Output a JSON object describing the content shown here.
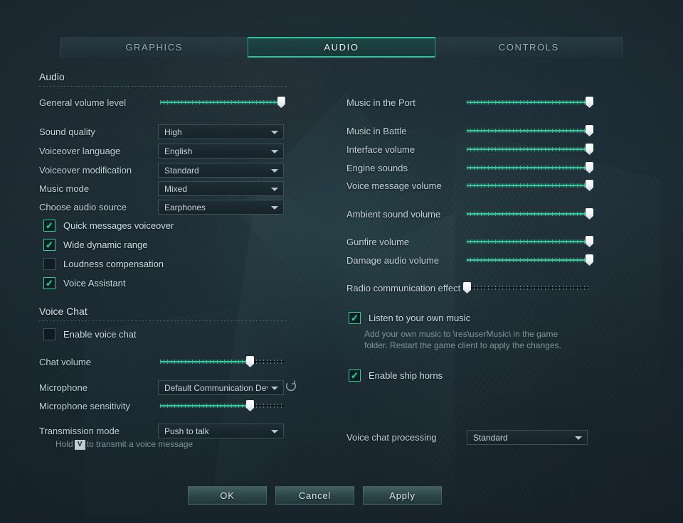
{
  "tabs": [
    {
      "label": "GRAPHICS",
      "active": false
    },
    {
      "label": "AUDIO",
      "active": true
    },
    {
      "label": "CONTROLS",
      "active": false
    }
  ],
  "sections": {
    "audio_title": "Audio",
    "voice_chat_title": "Voice Chat"
  },
  "left": {
    "general_volume": {
      "label": "General volume level",
      "value": 97
    },
    "dropdowns": [
      {
        "label": "Sound quality",
        "value": "High"
      },
      {
        "label": "Voiceover language",
        "value": "English"
      },
      {
        "label": "Voiceover modification",
        "value": "Standard"
      },
      {
        "label": "Music mode",
        "value": "Mixed"
      },
      {
        "label": "Choose audio source",
        "value": "Earphones"
      }
    ],
    "checkboxes": [
      {
        "label": "Quick messages voiceover",
        "checked": true
      },
      {
        "label": "Wide dynamic range",
        "checked": true
      },
      {
        "label": "Loudness compensation",
        "checked": false
      },
      {
        "label": "Voice Assistant",
        "checked": true
      }
    ],
    "enable_voice_chat": {
      "label": "Enable voice chat",
      "checked": false
    },
    "chat_volume": {
      "label": "Chat volume",
      "value": 72
    },
    "microphone": {
      "label": "Microphone",
      "value": "Default Communication Device"
    },
    "microphone_sensitivity": {
      "label": "Microphone sensitivity",
      "value": 72
    },
    "transmission_mode": {
      "label": "Transmission mode",
      "value": "Push to talk"
    },
    "push_hint": {
      "prefix": "Hold",
      "key": "V",
      "suffix": "to transmit a voice message"
    }
  },
  "right": {
    "sliders": [
      {
        "label": "Music in the Port",
        "value": 100
      },
      {
        "label": "Music in Battle",
        "value": 100
      },
      {
        "label": "Interface volume",
        "value": 100
      },
      {
        "label": "Engine sounds",
        "value": 100
      },
      {
        "label": "Voice message volume",
        "value": 100
      },
      {
        "label": "Ambient sound volume",
        "value": 100
      },
      {
        "label": "Gunfire volume",
        "value": 100
      },
      {
        "label": "Damage audio volume",
        "value": 100
      },
      {
        "label": "Radio communication effect",
        "value": 0
      }
    ],
    "own_music": {
      "label": "Listen to your own music",
      "checked": true
    },
    "own_music_hint": "Add your own music to \\res\\userMusic\\ in the game folder. Restart the game client to apply the changes.",
    "ship_horns": {
      "label": "Enable ship horns",
      "checked": true
    },
    "voice_chat_processing": {
      "label": "Voice chat processing",
      "value": "Standard"
    }
  },
  "buttons": [
    {
      "label": "OK"
    },
    {
      "label": "Cancel"
    },
    {
      "label": "Apply"
    }
  ],
  "colors": {
    "accent": "#2ecf9a",
    "background": "#22313a",
    "text": "#c3d2d8"
  },
  "icons": {
    "refresh": "refresh-icon",
    "caret": "chevron-down-icon",
    "check": "check-icon"
  }
}
